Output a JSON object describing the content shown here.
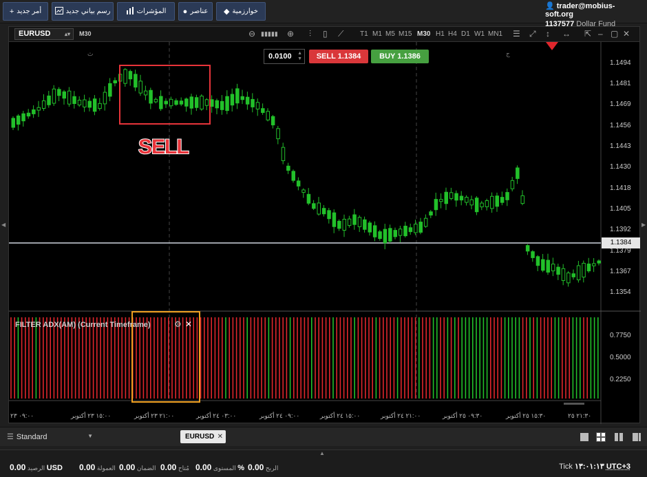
{
  "toolbar": {
    "new_order": "أمر جديد",
    "new_chart": "رسم بياني جديد",
    "indicators": "المؤشرات",
    "elements": "عناصر",
    "algorithms": "خوارزمية"
  },
  "account": {
    "user": "trader@mobius-soft.org",
    "account_id": "1137577",
    "fund_name": "Dollar Fund"
  },
  "chart": {
    "symbol": "EURUSD",
    "timeframe": "M30",
    "timeframes": [
      "T1",
      "M1",
      "M5",
      "M15",
      "M30",
      "H1",
      "H4",
      "D1",
      "W1",
      "MN1"
    ],
    "active_timeframe": "M30",
    "lot": "0.0100",
    "sell_label": "SELL 1.1384",
    "buy_label": "BUY 1.1386",
    "current_price": "1.1384",
    "price_axis": [
      "1.1494",
      "1.1481",
      "1.1469",
      "1.1456",
      "1.1443",
      "1.1430",
      "1.1418",
      "1.1405",
      "1.1392",
      "1.1379",
      "1.1367",
      "1.1354"
    ],
    "session_markers": [
      "ث",
      "ج"
    ],
    "annotation": "SELL",
    "indicator": {
      "title": "FILTER ADX(AM) (Current Timeframe)",
      "levels": [
        "0.7750",
        "0.5000",
        "0.2250"
      ]
    },
    "time_axis": [
      "٠٩:٠٠ ٢٣",
      "١٥:٠٠ ٢٣ أكتوبر",
      "٢١:٠٠ ٢٣ أكتوبر",
      "٠٣:٠٠ ٢٤ أكتوبر",
      "٠٩:٠٠ ٢٤ أكتوبر",
      "١٥:٠٠ ٢٤ أكتوبر",
      "٢١:٠٠ ٢٤ أكتوبر",
      "٠٩:٣٠ ٢٥ أكتوبر",
      "١٥:٣٠ ٢٥ أكتوبر",
      "٢١:٣٠ ٢٥"
    ],
    "colors": {
      "bull": "#22c02a",
      "bear": "#e0262c",
      "sell_box": "#e8343a",
      "indicator_box": "#f0a020"
    }
  },
  "tabs": {
    "layout": "Standard",
    "chart_tab": "EURUSD"
  },
  "status": {
    "balance_label": "الرصيد",
    "balance_value": "0.00",
    "currency": "USD",
    "commission_label": "العمولة",
    "commission_value": "0.00",
    "margin_label": "الضمان",
    "margin_value": "0.00",
    "free_label": "مُتاح",
    "free_value": "0.00",
    "level_label": "المستوى",
    "level_value": "0.00",
    "level_unit": "%",
    "profit_label": "الربح",
    "profit_value": "0.00",
    "tick_label": "Tick",
    "clock": "١٣:٠١:١٣",
    "timezone": "UTC+3"
  }
}
